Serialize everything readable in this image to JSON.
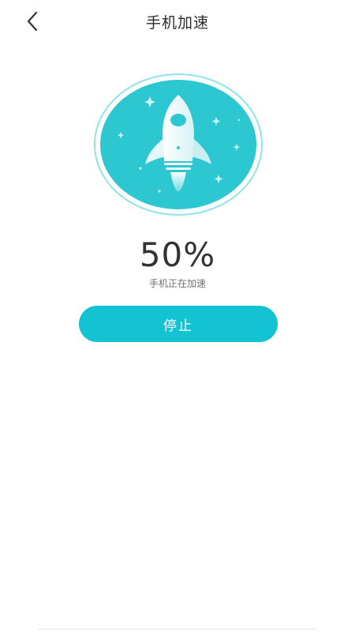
{
  "header": {
    "title": "手机加速",
    "back_icon": "chevron-left-icon"
  },
  "hero": {
    "icon": "rocket-icon",
    "circle_color": "#2cc7d1",
    "ring_color": "#8fe3ea"
  },
  "progress": {
    "percent_label": "50%",
    "value": 0.5,
    "status_text": "手机正在加速"
  },
  "actions": {
    "stop_label": "停止",
    "button_color": "#14c3d2"
  }
}
